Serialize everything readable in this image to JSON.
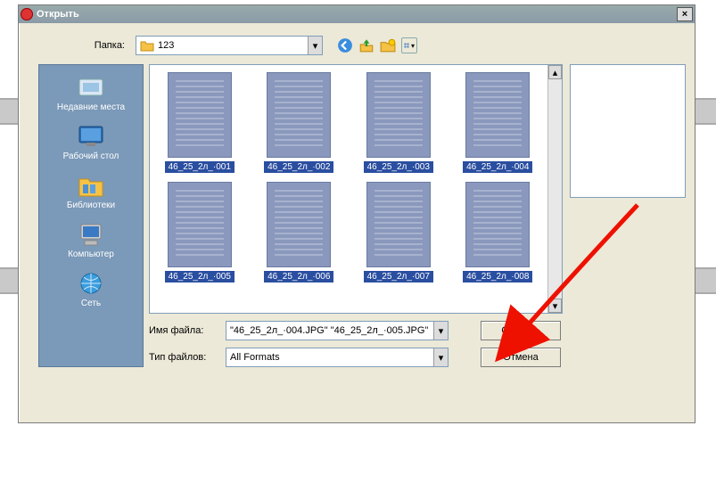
{
  "dialog": {
    "title": "Открыть",
    "close": "×",
    "folder_label": "Папка:",
    "folder_value": "123",
    "places": [
      {
        "label": "Недавние места"
      },
      {
        "label": "Рабочий стол"
      },
      {
        "label": "Библиотеки"
      },
      {
        "label": "Компьютер"
      },
      {
        "label": "Сеть"
      }
    ],
    "files": [
      {
        "name": "46_25_2л_·001"
      },
      {
        "name": "46_25_2л_·002"
      },
      {
        "name": "46_25_2л_·003"
      },
      {
        "name": "46_25_2л_·004"
      },
      {
        "name": "46_25_2л_·005"
      },
      {
        "name": "46_25_2л_·006"
      },
      {
        "name": "46_25_2л_·007"
      },
      {
        "name": "46_25_2л_·008"
      }
    ],
    "filename_label": "Имя файла:",
    "filename_value": "\"46_25_2л_·004.JPG\" \"46_25_2л_·005.JPG\"",
    "filetype_label": "Тип файлов:",
    "filetype_value": "All Formats",
    "open_button": "Открыть",
    "cancel_button": "Отмена"
  }
}
